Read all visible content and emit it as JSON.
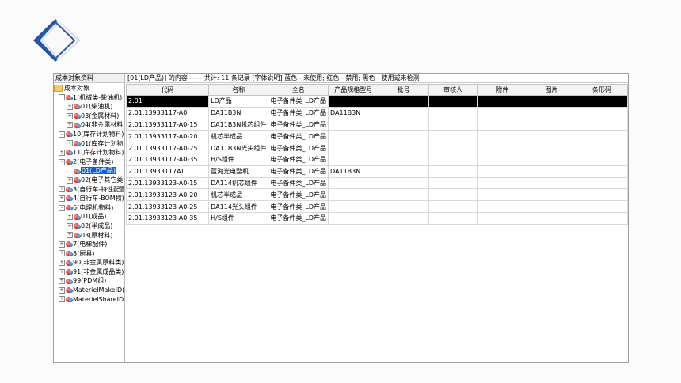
{
  "left": {
    "header": "成本对象资料",
    "root": "成本对象",
    "tree": [
      {
        "label": "1(机械类-柴油机)",
        "depth": 1,
        "exp": "-"
      },
      {
        "label": "01(柴油机)",
        "depth": 2,
        "exp": "+"
      },
      {
        "label": "03(金属材料)",
        "depth": 2,
        "exp": "+"
      },
      {
        "label": "04(非金属材料)",
        "depth": 2,
        "exp": "+"
      },
      {
        "label": "10(库存计划物料)",
        "depth": 1,
        "exp": "-"
      },
      {
        "label": "01(库存计划物",
        "depth": 2,
        "exp": "+"
      },
      {
        "label": "11(库存计划物料)",
        "depth": 1,
        "exp": "+"
      },
      {
        "label": "2(电子备件类)",
        "depth": 1,
        "exp": "-"
      },
      {
        "label": "01(LD产品)",
        "depth": 2,
        "exp": "",
        "selected": true
      },
      {
        "label": "02(电子其它类",
        "depth": 2,
        "exp": "+"
      },
      {
        "label": "3(自行车-特性配置",
        "depth": 1,
        "exp": "+"
      },
      {
        "label": "4(自行车-BOM物)",
        "depth": 1,
        "exp": "+"
      },
      {
        "label": "6(电焊机物料)",
        "depth": 1,
        "exp": "-"
      },
      {
        "label": "01(成品)",
        "depth": 2,
        "exp": "+"
      },
      {
        "label": "02(半成品)",
        "depth": 2,
        "exp": "+"
      },
      {
        "label": "03(原材料)",
        "depth": 2,
        "exp": "+"
      },
      {
        "label": "7(电梯配件)",
        "depth": 1,
        "exp": "+"
      },
      {
        "label": "8(厨具)",
        "depth": 1,
        "exp": "+"
      },
      {
        "label": "90(非金属原料类)",
        "depth": 1,
        "exp": "+"
      },
      {
        "label": "91(非金属成品类)",
        "depth": 1,
        "exp": "+"
      },
      {
        "label": "99(PDM组)",
        "depth": 1,
        "exp": "+"
      },
      {
        "label": "MaterielMakeID(标",
        "depth": 1,
        "exp": "+"
      },
      {
        "label": "MaterielShareID(共",
        "depth": 1,
        "exp": "+"
      }
    ]
  },
  "right": {
    "info": "[01(LD产品)] 的内容 —— 共计: 11 条记录 [字体说明] 蓝色 - 未使用; 红色 - 禁用; 黑色 - 使用或未检测",
    "columns": [
      "代码",
      "名称",
      "全名",
      "产品规格型号",
      "批号",
      "审核人",
      "附件",
      "图片",
      "条形码"
    ],
    "rows": [
      [
        "2.01",
        "LD产品",
        "电子备件类_LD产品",
        "",
        "",
        "",
        "",
        "",
        ""
      ],
      [
        "2.01.13933117-A0",
        "DA11B3N",
        "电子备件类_LD产品",
        "DA11B3N",
        "",
        "",
        "",
        "",
        ""
      ],
      [
        "2.01.13933117-A0-15",
        "DA11B3N机芯组件",
        "电子备件类_LD产品",
        "",
        "",
        "",
        "",
        "",
        ""
      ],
      [
        "2.01.13933117-A0-20",
        "机芯半成品",
        "电子备件类_LD产品",
        "",
        "",
        "",
        "",
        "",
        ""
      ],
      [
        "2.01.13933117-A0-25",
        "DA11B3N光头组件",
        "电子备件类_LD产品",
        "",
        "",
        "",
        "",
        "",
        ""
      ],
      [
        "2.01.13933117-A0-35",
        "H/S组件",
        "电子备件类_LD产品",
        "",
        "",
        "",
        "",
        "",
        ""
      ],
      [
        "2.01.13933117AT",
        "蓝海光电整机",
        "电子备件类_LD产品",
        "DA11B3N",
        "",
        "",
        "",
        "",
        ""
      ],
      [
        "2.01.13933123-A0-15",
        "DA114机芯组件",
        "电子备件类_LD产品",
        "",
        "",
        "",
        "",
        "",
        ""
      ],
      [
        "2.01.13933123-A0-20",
        "机芯半成品",
        "电子备件类_LD产品",
        "",
        "",
        "",
        "",
        "",
        ""
      ],
      [
        "2.01.13933123-A0-25",
        "DA114光头组件",
        "电子备件类_LD产品",
        "",
        "",
        "",
        "",
        "",
        ""
      ],
      [
        "2.01.13933123-A0-35",
        "H/S组件",
        "电子备件类_LD产品",
        "",
        "",
        "",
        "",
        "",
        ""
      ]
    ],
    "selected_row": 0
  },
  "colors": {
    "selection": "#0a5fd6",
    "accent_blue": "#2e5aa8"
  }
}
